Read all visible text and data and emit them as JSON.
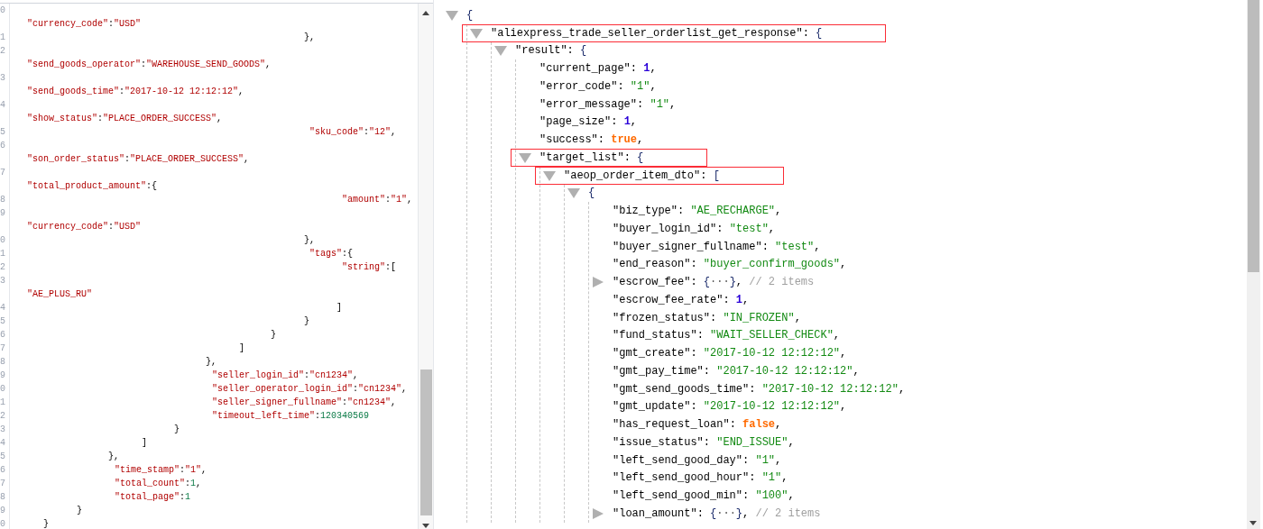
{
  "source_editor": {
    "lines": [
      {
        "number": "0",
        "text": "\"currency_code\":\"USD\"",
        "wrapped": true
      },
      {
        "number": "1",
        "text": "},",
        "wrapped": false
      },
      {
        "number": "2",
        "text": "\"send_goods_operator\":\"WAREHOUSE_SEND_GOODS\",",
        "wrapped": true
      },
      {
        "number": "3",
        "text": "\"send_goods_time\":\"2017-10-12 12:12:12\",",
        "wrapped": true
      },
      {
        "number": "4",
        "text": "\"show_status\":\"PLACE_ORDER_SUCCESS\",",
        "wrapped": true
      },
      {
        "number": "5",
        "text": "\"sku_code\":\"12\",",
        "wrapped": false
      },
      {
        "number": "6",
        "text": "\"son_order_status\":\"PLACE_ORDER_SUCCESS\",",
        "wrapped": true
      },
      {
        "number": "7",
        "text": "\"total_product_amount\":{",
        "wrapped": true
      },
      {
        "number": "8",
        "text": "\"amount\":\"1\",",
        "wrapped": false
      },
      {
        "number": "9",
        "text": "\"currency_code\":\"USD\"",
        "wrapped": true
      },
      {
        "number": "0",
        "text": "},",
        "wrapped": false
      },
      {
        "number": "1",
        "text": "\"tags\":{",
        "wrapped": false
      },
      {
        "number": "2",
        "text": "\"string\":[",
        "wrapped": false
      },
      {
        "number": "3",
        "text": "\"AE_PLUS_RU\"",
        "wrapped": true
      },
      {
        "number": "4",
        "text": "]",
        "wrapped": false
      },
      {
        "number": "5",
        "text": "}",
        "wrapped": false
      },
      {
        "number": "6",
        "text": "}",
        "wrapped": false
      },
      {
        "number": "7",
        "text": "]",
        "wrapped": false
      },
      {
        "number": "8",
        "text": "},",
        "wrapped": false
      },
      {
        "number": "9",
        "text": "\"seller_login_id\":\"cn1234\",",
        "wrapped": false
      },
      {
        "number": "0",
        "text": "\"seller_operator_login_id\":\"cn1234\",",
        "wrapped": false
      },
      {
        "number": "1",
        "text": "\"seller_signer_fullname\":\"cn1234\",",
        "wrapped": false
      },
      {
        "number": "2",
        "text": "\"timeout_left_time\":120340569",
        "wrapped": false
      },
      {
        "number": "3",
        "text": "}",
        "wrapped": false
      },
      {
        "number": "4",
        "text": "]",
        "wrapped": false
      },
      {
        "number": "5",
        "text": "},",
        "wrapped": false
      },
      {
        "number": "6",
        "text": "\"time_stamp\":\"1\",",
        "wrapped": false
      },
      {
        "number": "7",
        "text": "\"total_count\":1,",
        "wrapped": false
      },
      {
        "number": "8",
        "text": "\"total_page\":1",
        "wrapped": false
      },
      {
        "number": "9",
        "text": "}",
        "wrapped": false
      },
      {
        "number": "0",
        "text": "}",
        "wrapped": false
      }
    ]
  },
  "json_viewer": {
    "tree": [
      {
        "text": "{",
        "expanded": true,
        "highlighted": false,
        "children": [
          {
            "text": "\"aliexpress_trade_seller_orderlist_get_response\": {",
            "expanded": true,
            "highlighted": true,
            "children": [
              {
                "text": "\"result\": {",
                "expanded": true,
                "highlighted": false,
                "children": [
                  {
                    "text": "\"current_page\": 1,"
                  },
                  {
                    "text": "\"error_code\": \"1\","
                  },
                  {
                    "text": "\"error_message\": \"1\","
                  },
                  {
                    "text": "\"page_size\": 1,"
                  },
                  {
                    "text": "\"success\": true,"
                  },
                  {
                    "text": "\"target_list\": {",
                    "expanded": true,
                    "highlighted": true,
                    "children": [
                      {
                        "text": "\"aeop_order_item_dto\": [",
                        "expanded": true,
                        "highlighted": true,
                        "children": [
                          {
                            "text": "{",
                            "expanded": true,
                            "highlighted": false,
                            "children": [
                              {
                                "text": "\"biz_type\": \"AE_RECHARGE\","
                              },
                              {
                                "text": "\"buyer_login_id\": \"test\","
                              },
                              {
                                "text": "\"buyer_signer_fullname\": \"test\","
                              },
                              {
                                "text": "\"end_reason\": \"buyer_confirm_goods\","
                              },
                              {
                                "text": "\"escrow_fee\": {···}, // 2 items",
                                "expanded": false,
                                "highlighted": false
                              },
                              {
                                "text": "\"escrow_fee_rate\": 1,"
                              },
                              {
                                "text": "\"frozen_status\": \"IN_FROZEN\","
                              },
                              {
                                "text": "\"fund_status\": \"WAIT_SELLER_CHECK\","
                              },
                              {
                                "text": "\"gmt_create\": \"2017-10-12 12:12:12\","
                              },
                              {
                                "text": "\"gmt_pay_time\": \"2017-10-12 12:12:12\","
                              },
                              {
                                "text": "\"gmt_send_goods_time\": \"2017-10-12 12:12:12\","
                              },
                              {
                                "text": "\"gmt_update\": \"2017-10-12 12:12:12\","
                              },
                              {
                                "text": "\"has_request_loan\": false,"
                              },
                              {
                                "text": "\"issue_status\": \"END_ISSUE\","
                              },
                              {
                                "text": "\"left_send_good_day\": \"1\","
                              },
                              {
                                "text": "\"left_send_good_hour\": \"1\","
                              },
                              {
                                "text": "\"left_send_good_min\": \"100\","
                              },
                              {
                                "text": "\"loan_amount\": {···}, // 2 items",
                                "expanded": false,
                                "highlighted": false
                              }
                            ]
                          }
                        ]
                      }
                    ]
                  }
                ]
              }
            ]
          }
        ]
      }
    ]
  }
}
